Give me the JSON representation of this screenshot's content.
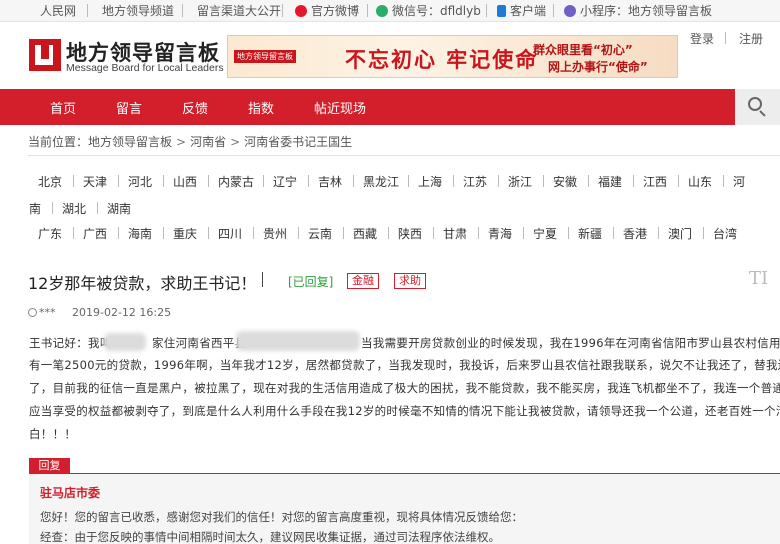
{
  "topbar": {
    "items": [
      "人民网",
      "地方领导频道",
      "留言渠道大公开",
      "官方微博",
      "微信号：dfldlyb",
      "客户端",
      "小程序：地方领导留言板"
    ]
  },
  "header": {
    "logo_cn": "地方领导留言板",
    "logo_en": "Message Board for Local Leaders",
    "banner": {
      "left": "地方领导留言板",
      "main": "不忘初心 牢记使命",
      "right1": "群众眼里看“初心”",
      "right2": "网上办事行“使命”"
    },
    "login": "登录",
    "register": "注册"
  },
  "nav": {
    "items": [
      "首页",
      "留言",
      "反馈",
      "指数",
      "帖近现场"
    ]
  },
  "breadcrumb": {
    "label": "当前位置：",
    "items": [
      "地方领导留言板",
      "河南省",
      "河南省委书记王国生"
    ]
  },
  "provinces": {
    "row1": [
      "北京",
      "天津",
      "河北",
      "山西",
      "内蒙古",
      "辽宁",
      "吉林",
      "黑龙江",
      "上海",
      "江苏",
      "浙江",
      "安徽",
      "福建",
      "江西",
      "山东",
      "河"
    ],
    "row2": [
      "南",
      "湖北",
      "湖南"
    ],
    "row3": [
      "广东",
      "广西",
      "海南",
      "重庆",
      "四川",
      "贵州",
      "云南",
      "西藏",
      "陕西",
      "甘肃",
      "青海",
      "宁夏",
      "新疆",
      "香港",
      "澳门",
      "台湾"
    ]
  },
  "message": {
    "title": "12岁那年被贷款，求助王书记！",
    "status": "[已回复]",
    "tags": [
      "金融",
      "求助"
    ],
    "tt_icon": "TI",
    "author": "***",
    "date": "2019-02-12 16:25",
    "body": [
      "王书记好：我叫",
      "家住河南省西平县",
      "当我需要开房贷款创业的时候发现，我在1996年在河南省信阳市罗山县农村信用社",
      "有一笔2500元的贷款，1996年啊，当年我才12岁，居然都贷款了，当我发现时，我投诉，后来罗山县农信社跟我联系，说欠不让我还了，替我还上",
      "了，目前我的征信一直是黑户，被拉黑了，现在对我的生活信用造成了极大的困扰，我不能贷款，我不能买房，我连飞机都坐不了，我连一个普通公民",
      "应当享受的权益都被剥夺了，到底是什么人利用什么手段在我12岁的时候毫不知情的情况下能让我被贷款，请领导还我一个公道，还老百姓一个清",
      "白！！！"
    ]
  },
  "reply": {
    "tag": "回复",
    "from": "驻马店市委",
    "lines": [
      "您好！您的留言已收悉，感谢您对我们的信任！对您的留言高度重视，现将具体情况反馈给您：",
      "经查：由于您反映的事情中间相隔时间太久，建议网民收集证据，通过司法程序依法维权。"
    ]
  }
}
